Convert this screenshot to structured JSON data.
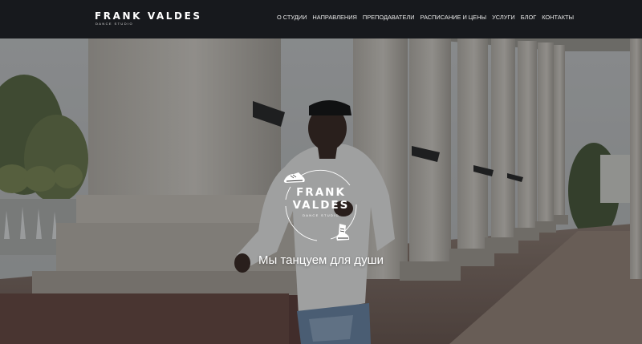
{
  "header": {
    "logo_title": "FRANK VALDES",
    "logo_subtitle": "DANCE STUDIO",
    "nav": [
      {
        "label": "О СТУДИИ"
      },
      {
        "label": "НАПРАВЛЕНИЯ"
      },
      {
        "label": "ПРЕПОДАВАТЕЛИ"
      },
      {
        "label": "РАСПИСАНИЕ И ЦЕНЫ"
      },
      {
        "label": "УСЛУГИ"
      },
      {
        "label": "БЛОГ"
      },
      {
        "label": "КОНТАКТЫ"
      }
    ]
  },
  "hero": {
    "emblem_title_line1": "FRANK",
    "emblem_title_line2": "VALDES",
    "emblem_subtitle": "DANCE STUDIO",
    "tagline": "Мы танцуем для души"
  },
  "colors": {
    "header_bg": "#17191d",
    "text": "#ffffff",
    "overlay": "rgba(10,12,16,0.34)"
  },
  "icons": [
    "sneaker-icon",
    "sneaker-icon"
  ]
}
